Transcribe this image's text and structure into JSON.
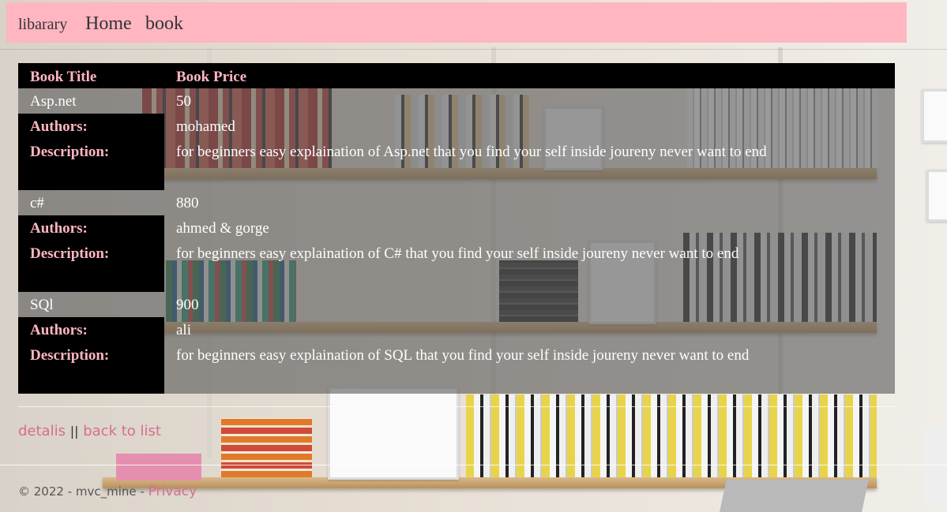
{
  "nav": {
    "brand": "libarary",
    "links": [
      "Home",
      "book"
    ]
  },
  "table": {
    "headers": {
      "title": "Book Title",
      "price": "Book Price"
    },
    "authors_label": "Authors:",
    "description_label": "Description:",
    "rows": [
      {
        "title": "Asp.net",
        "price": "50",
        "authors": "mohamed",
        "description": "for beginners easy explaination of Asp.net that you find your self inside joureny never want to end"
      },
      {
        "title": "c#",
        "price": "880",
        "authors": "ahmed & gorge",
        "description": "for beginners easy explaination of C# that you find your self inside joureny never want to end"
      },
      {
        "title": "SQl",
        "price": "900",
        "authors": "ali",
        "description": "for beginners easy explaination of SQL that you find your self inside joureny never want to end"
      }
    ]
  },
  "actions": {
    "details_link": "detalis",
    "separator": "||",
    "back_link": "back to list"
  },
  "footer": {
    "copyright": "© 2022 - mvc_mine - ",
    "privacy_link": "Privacy"
  },
  "colors": {
    "nav_bg": "#ffb6c1",
    "header_text": "#ffb6c1",
    "link": "#d86d8f"
  }
}
